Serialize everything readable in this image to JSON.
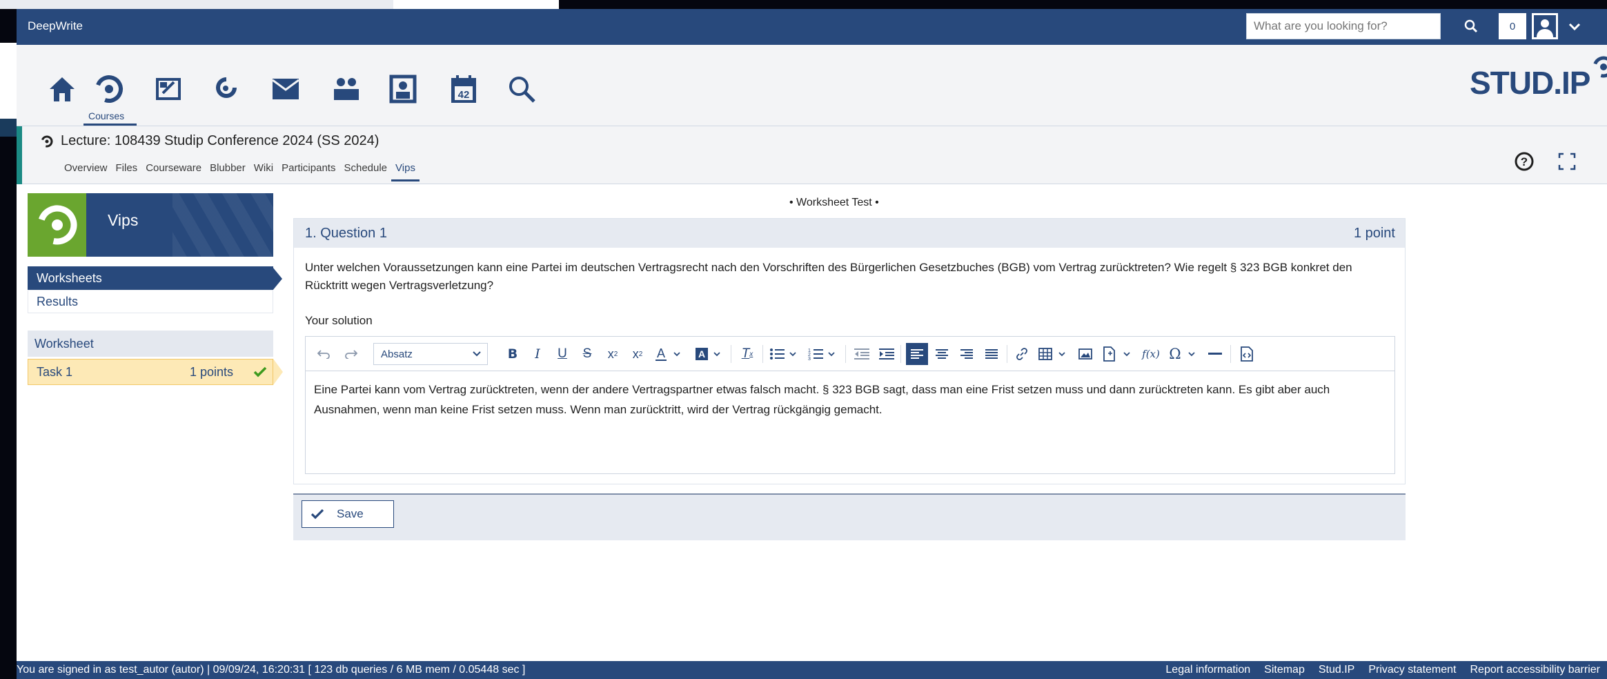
{
  "topbar": {
    "brand": "DeepWrite",
    "search_placeholder": "What are you looking for?",
    "notification_count": "0"
  },
  "nav": {
    "items": [
      "home",
      "courses",
      "my-workplace",
      "community",
      "messages",
      "contacts",
      "profile",
      "planner",
      "search"
    ],
    "active_label": "Courses",
    "logo_text": "STUD.IP"
  },
  "context": {
    "title": "Lecture: 108439 Studip Conference 2024 (SS 2024)",
    "tabs": [
      "Overview",
      "Files",
      "Courseware",
      "Blubber",
      "Wiki",
      "Participants",
      "Schedule",
      "Vips"
    ],
    "active_tab": "Vips"
  },
  "sidebar": {
    "title": "Vips",
    "nav": [
      "Worksheets",
      "Results"
    ],
    "worksheet_heading": "Worksheet",
    "task_label": "Task 1",
    "task_points": "1 points"
  },
  "main": {
    "worksheet_title": "• Worksheet Test •",
    "question_title": "1. Question 1",
    "question_points": "1 point",
    "question_text": "Unter welchen Voraussetzungen kann eine Partei im deutschen Vertragsrecht nach den Vorschriften des Bürgerlichen Gesetzbuches (BGB) vom Vertrag zurücktreten? Wie regelt § 323 BGB konkret den Rücktritt wegen Vertragsverletzung?",
    "solution_label": "Your solution",
    "format_select": "Absatz",
    "answer": "Eine Partei kann vom Vertrag zurücktreten, wenn der andere Vertragspartner etwas falsch macht. § 323 BGB sagt, dass man eine Frist setzen muss und dann zurücktreten kann. Es gibt aber auch Ausnahmen, wenn man keine Frist setzen muss. Wenn man zurücktritt, wird der Vertrag rückgängig gemacht.",
    "save_label": "Save"
  },
  "footer": {
    "status": "You are signed in as test_autor (autor) | 09/09/24, 16:20:31 [ 123 db queries / 6 MB mem / 0.05448 sec ]",
    "links": [
      "Legal information",
      "Sitemap",
      "Stud.IP",
      "Privacy statement",
      "Report accessibility barrier"
    ]
  },
  "colors": {
    "primary": "#28497c",
    "vips_green": "#6aa62f",
    "task_highlight": "#fde9b6",
    "check_green": "#3e9a1f",
    "context_accent": "#1b8a84"
  }
}
